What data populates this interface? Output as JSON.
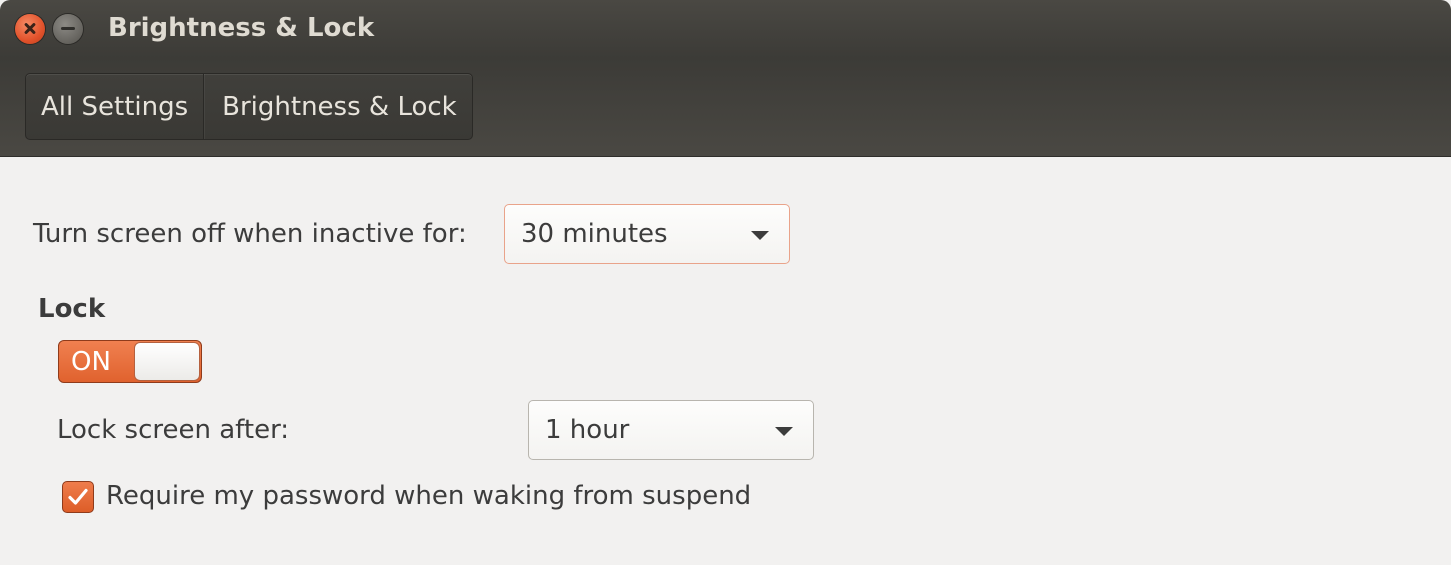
{
  "window": {
    "title": "Brightness & Lock"
  },
  "titlebar": {
    "close_icon": "close-icon",
    "minimize_icon": "minimize-icon"
  },
  "breadcrumb": {
    "items": [
      "All Settings",
      "Brightness & Lock"
    ]
  },
  "screen_off": {
    "label": "Turn screen off when inactive for:",
    "value": "30 minutes"
  },
  "lock": {
    "section_title": "Lock",
    "switch_label": "ON",
    "switch_state": true,
    "after_label": "Lock screen after:",
    "after_value": "1 hour",
    "require_password_label": "Require my password when waking from suspend",
    "require_password_checked": true
  },
  "colors": {
    "accent": "#e0622e",
    "titlebar": "#3c3b37",
    "background": "#f2f1f0"
  }
}
